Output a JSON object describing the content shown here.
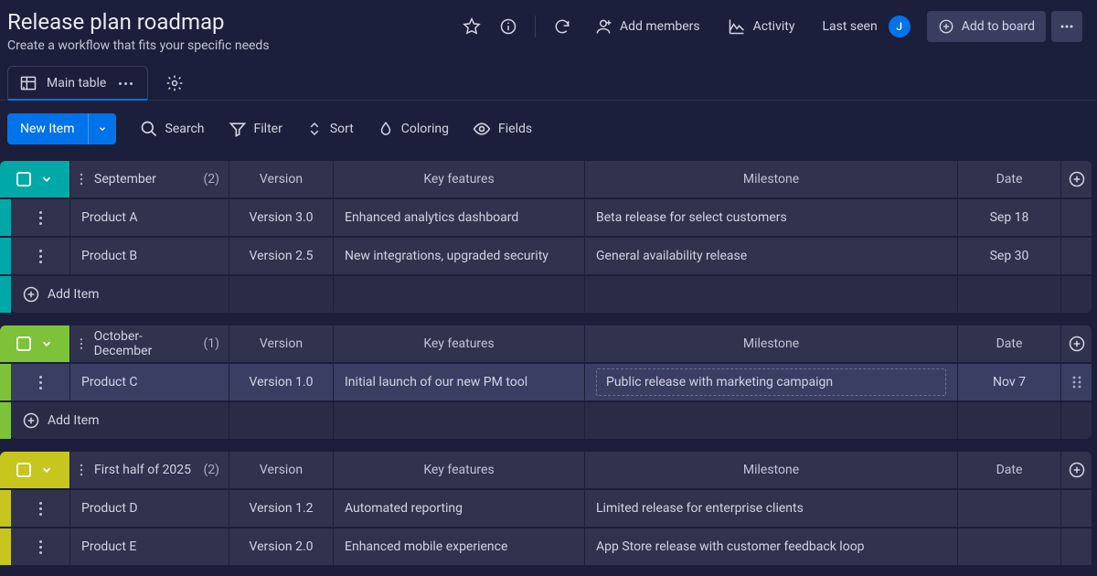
{
  "header": {
    "title": "Release plan roadmap",
    "subtitle": "Create a workflow that fits your specific needs",
    "add_members": "Add members",
    "activity": "Activity",
    "last_seen": "Last seen",
    "avatar_initial": "J",
    "add_to_board": "Add to board"
  },
  "tabs": {
    "main": "Main table"
  },
  "toolbar": {
    "new_item": "New Item",
    "search": "Search",
    "filter": "Filter",
    "sort": "Sort",
    "coloring": "Coloring",
    "fields": "Fields"
  },
  "columns": {
    "version": "Version",
    "features": "Key features",
    "milestone": "Milestone",
    "date": "Date"
  },
  "add_item": "Add Item",
  "groups": [
    {
      "name": "September",
      "count": "(2)",
      "rows": [
        {
          "name": "Product A",
          "version": "Version 3.0",
          "features": "Enhanced analytics dashboard",
          "milestone": "Beta release for select customers",
          "date": "Sep 18"
        },
        {
          "name": "Product B",
          "version": "Version 2.5",
          "features": "New integrations, upgraded security",
          "milestone": "General availability release",
          "date": "Sep 30"
        }
      ]
    },
    {
      "name": "October-December",
      "count": "(1)",
      "rows": [
        {
          "name": "Product C",
          "version": "Version 1.0",
          "features": "Initial launch of our new PM tool",
          "milestone": "Public release with marketing campaign",
          "date": "Nov 7"
        }
      ]
    },
    {
      "name": "First half of 2025",
      "count": "(2)",
      "rows": [
        {
          "name": "Product D",
          "version": "Version 1.2",
          "features": "Automated reporting",
          "milestone": "Limited release for enterprise clients",
          "date": ""
        },
        {
          "name": "Product E",
          "version": "Version 2.0",
          "features": "Enhanced mobile experience",
          "milestone": "App Store release with customer feedback loop",
          "date": ""
        }
      ]
    }
  ]
}
